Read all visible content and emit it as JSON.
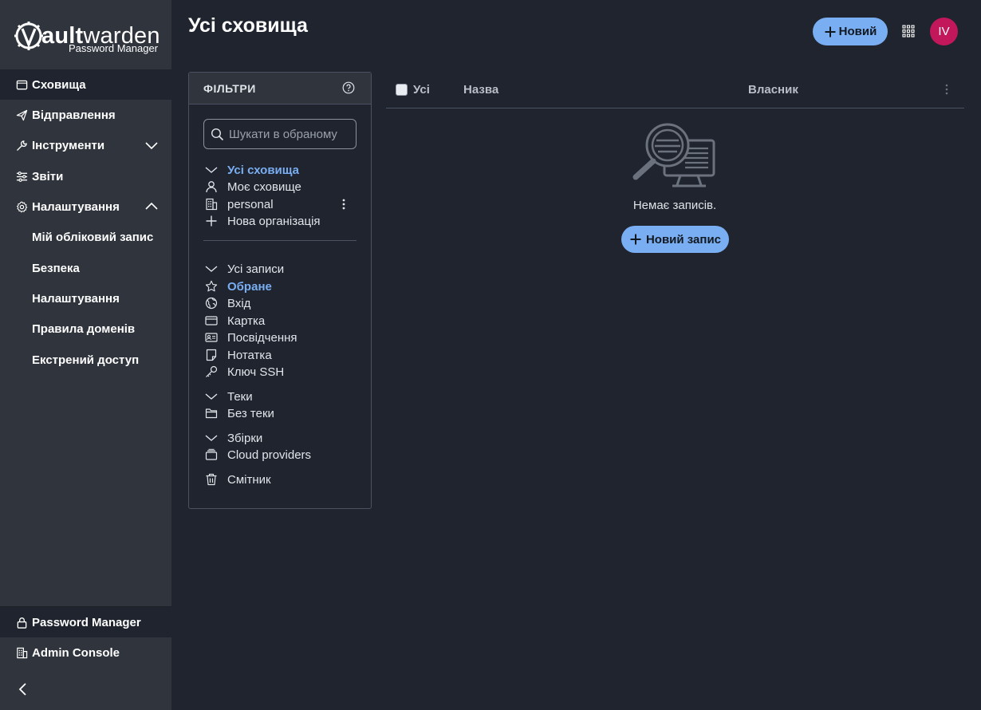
{
  "brand": {
    "logo_main": "ault",
    "logo_rest": "warden",
    "logo_sub": "Password Manager"
  },
  "sidebar": {
    "items": [
      {
        "label": "Сховища",
        "icon": "vault-icon",
        "active": true
      },
      {
        "label": "Відправлення",
        "icon": "send-icon"
      },
      {
        "label": "Інструменти",
        "icon": "wrench-icon",
        "expandable": true,
        "expanded": false
      },
      {
        "label": "Звіти",
        "icon": "sliders-icon"
      },
      {
        "label": "Налаштування",
        "icon": "gear-icon",
        "expandable": true,
        "expanded": true
      }
    ],
    "settings_sub": [
      "Мій обліковий запис",
      "Безпека",
      "Налаштування",
      "Правила доменів",
      "Екстрений доступ"
    ],
    "footer": [
      {
        "label": "Password Manager",
        "icon": "lock-icon",
        "active": true
      },
      {
        "label": "Admin Console",
        "icon": "building-icon"
      }
    ]
  },
  "header": {
    "title": "Усі сховища",
    "new_button": "Новий",
    "avatar_initials": "IV",
    "avatar_color": "#c2185b"
  },
  "filters": {
    "title": "ФІЛЬТРИ",
    "search_placeholder": "Шукати в обраному",
    "vaults": [
      "Усі сховища",
      "Моє сховище",
      "personal",
      "Нова організація"
    ],
    "types": [
      "Усі записи",
      "Обране",
      "Вхід",
      "Картка",
      "Посвідчення",
      "Нотатка",
      "Ключ SSH"
    ],
    "folders": [
      "Теки",
      "Без теки"
    ],
    "collections": [
      "Збірки",
      "Cloud providers"
    ],
    "trash": "Смітник"
  },
  "table": {
    "select_all": "Усі",
    "col_name": "Назва",
    "col_owner": "Власник"
  },
  "empty": {
    "message": "Немає записів.",
    "button": "Новий запис"
  },
  "colors": {
    "accent": "#79aef2",
    "sidebar_bg": "#2f343d",
    "page_bg": "#1f242e"
  }
}
